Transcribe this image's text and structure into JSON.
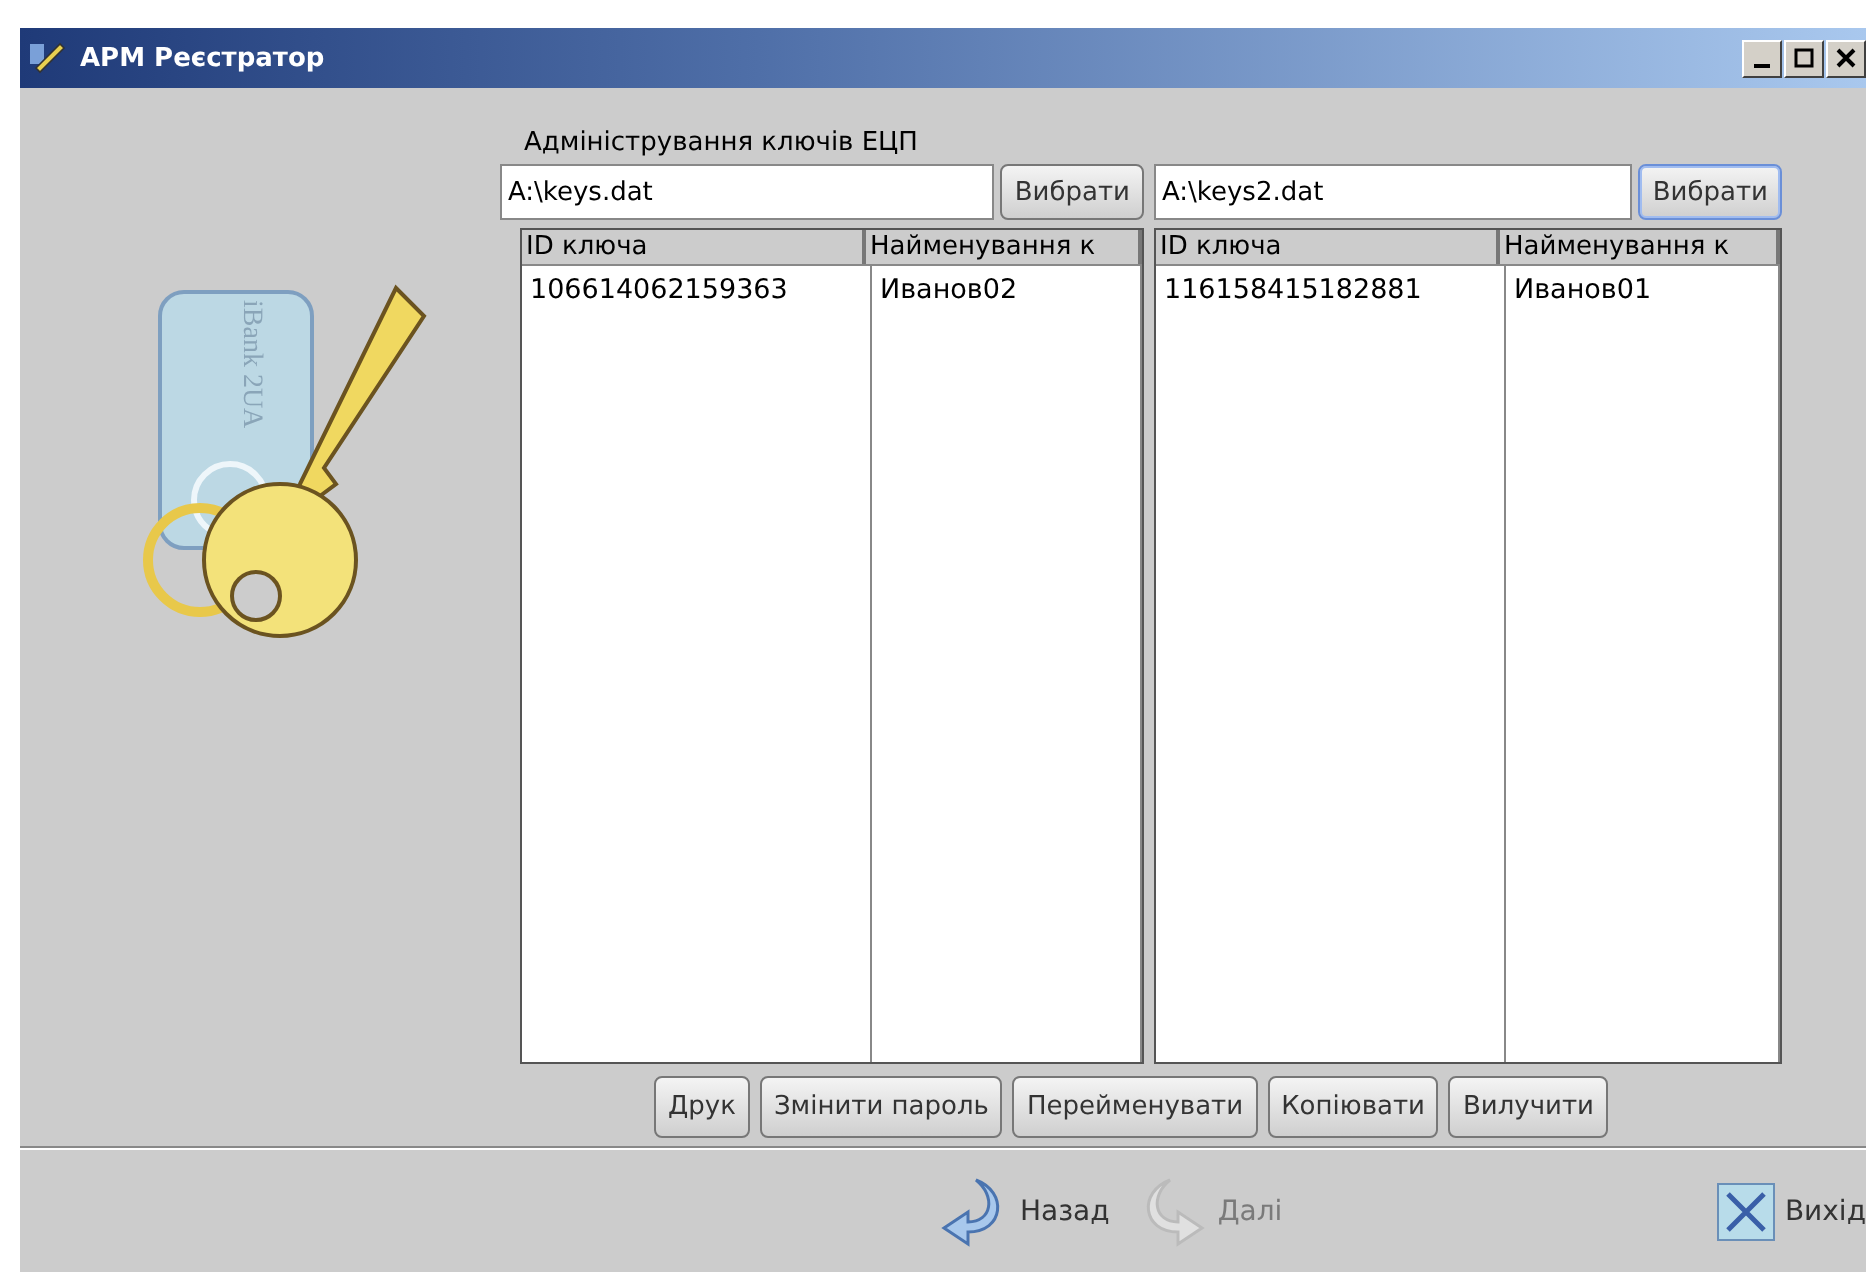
{
  "window": {
    "title": "АРМ Реєстратор"
  },
  "logo_text": "iBank 2UA",
  "section_label": "Адміністрування ключів ЕЦП",
  "panels": [
    {
      "file": {
        "value": "A:\\keys.dat"
      },
      "browse_button": {
        "label": "Вибрати",
        "focused": false
      },
      "table": {
        "columns": [
          "ID ключа",
          "Найменування к"
        ],
        "rows": [
          [
            "106614062159363",
            "Иванов02"
          ]
        ]
      }
    },
    {
      "file": {
        "value": "A:\\keys2.dat"
      },
      "browse_button": {
        "label": "Вибрати",
        "focused": true
      },
      "table": {
        "columns": [
          "ID ключа",
          "Найменування к"
        ],
        "rows": [
          [
            "116158415182881",
            "Иванов01"
          ]
        ]
      }
    }
  ],
  "actions": [
    "Друк",
    "Змінити пароль",
    "Перейменувати",
    "Копіювати",
    "Вилучити"
  ],
  "nav": [
    {
      "kind": "back",
      "label": "Назад",
      "disabled": false
    },
    {
      "kind": "next",
      "label": "Далі",
      "disabled": true
    }
  ],
  "exit_button": {
    "label": "Вихід"
  }
}
